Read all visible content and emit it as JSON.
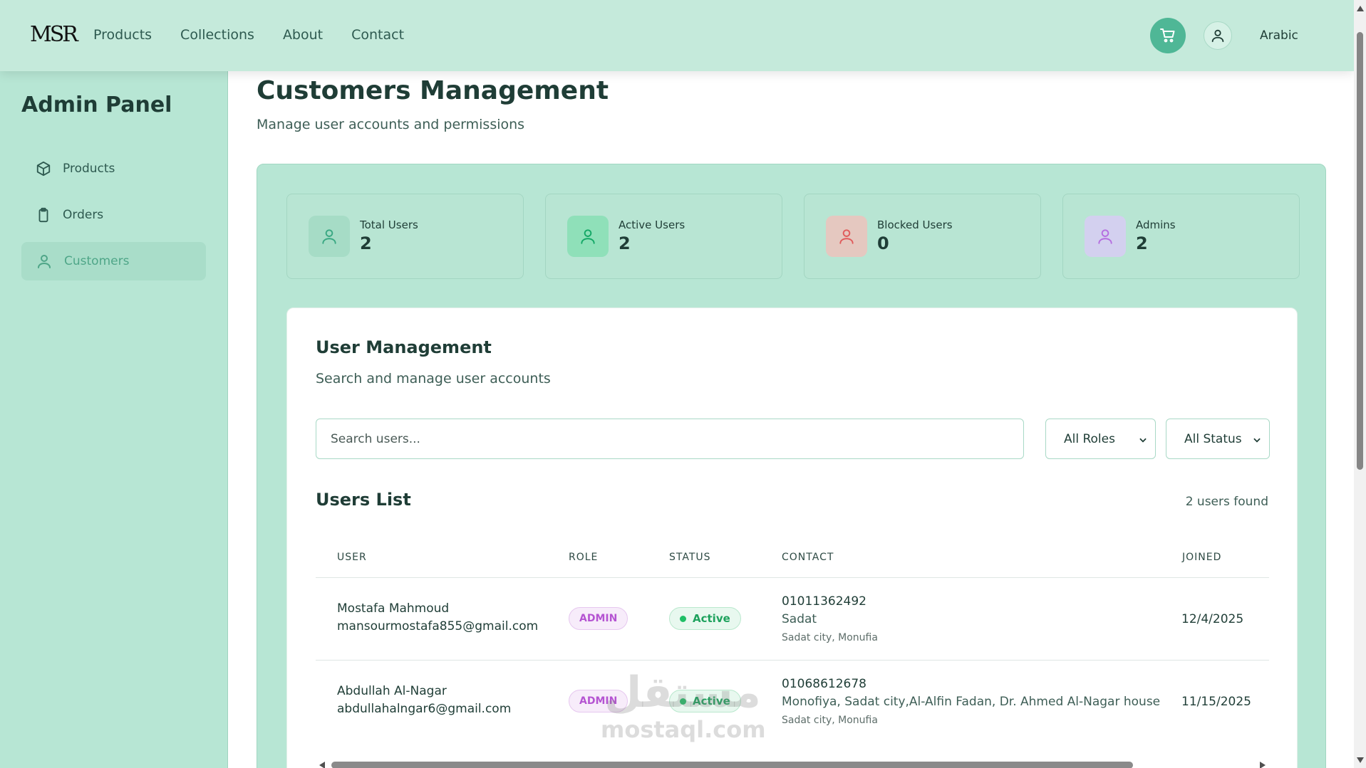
{
  "brand": {
    "logo_text": "MSR"
  },
  "nav": {
    "items": [
      "Products",
      "Collections",
      "About",
      "Contact"
    ],
    "language": "Arabic"
  },
  "sidebar": {
    "title": "Admin Panel",
    "items": [
      {
        "label": "Products",
        "icon": "box-icon"
      },
      {
        "label": "Orders",
        "icon": "clipboard-icon"
      },
      {
        "label": "Customers",
        "icon": "user-icon",
        "active": true
      }
    ]
  },
  "page": {
    "title": "Customers Management",
    "subtitle": "Manage user accounts and permissions"
  },
  "stats": [
    {
      "label": "Total Users",
      "value": "2",
      "color": "#3aa883"
    },
    {
      "label": "Active Users",
      "value": "2",
      "color": "#22c07a"
    },
    {
      "label": "Blocked Users",
      "value": "0",
      "color": "#e05b5b"
    },
    {
      "label": "Admins",
      "value": "2",
      "color": "#b56ee0"
    }
  ],
  "management": {
    "title": "User Management",
    "subtitle": "Search and manage user accounts",
    "search_placeholder": "Search users...",
    "role_filter": "All Roles",
    "status_filter": "All Status"
  },
  "users_list": {
    "title": "Users List",
    "count_text": "2 users found",
    "columns": [
      "USER",
      "ROLE",
      "STATUS",
      "CONTACT",
      "JOINED"
    ],
    "rows": [
      {
        "name": "Mostafa Mahmoud",
        "email": "mansourmostafa855@gmail.com",
        "role": "ADMIN",
        "status": "Active",
        "phone": "01011362492",
        "address": "Sadat",
        "city": "Sadat city, Monufia",
        "joined": "12/4/2025"
      },
      {
        "name": "Abdullah Al-Nagar",
        "email": "abdullahalngar6@gmail.com",
        "role": "ADMIN",
        "status": "Active",
        "phone": "01068612678",
        "address": "Monofiya, Sadat city,Al-Alfin Fadan, Dr. Ahmed Al-Nagar house",
        "city": "Sadat city, Monufia",
        "joined": "11/15/2025"
      }
    ]
  },
  "watermark": {
    "arabic": "مستقل",
    "latin": "mostaql.com"
  },
  "colors": {
    "accent": "#4fb796",
    "topbar": "#c5eadb",
    "sidebar": "#b7e6d4",
    "admin_badge": "#b554d2",
    "active_badge": "#1ea25d"
  }
}
